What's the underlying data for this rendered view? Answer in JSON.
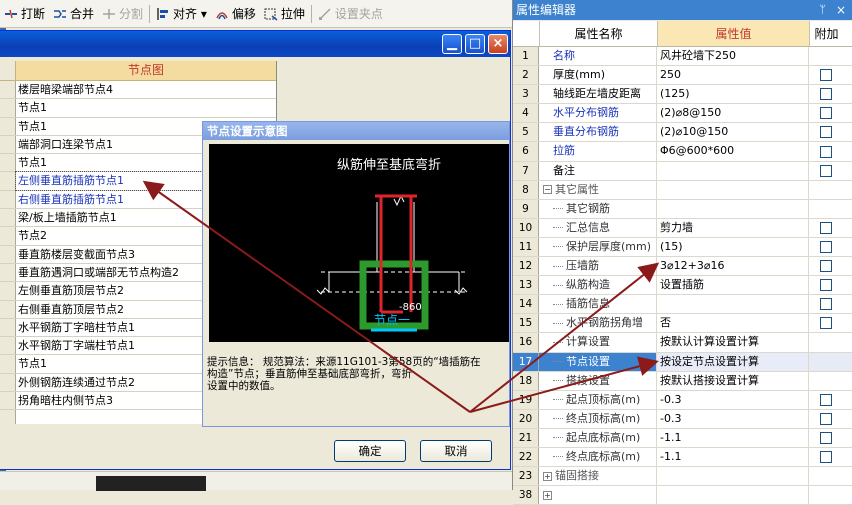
{
  "toolbar": {
    "items": [
      {
        "label": "打断",
        "disabled": false
      },
      {
        "label": "合并",
        "disabled": false
      },
      {
        "label": "分割",
        "disabled": true
      },
      {
        "label": "对齐 ▾",
        "disabled": false
      },
      {
        "label": "偏移",
        "disabled": false
      },
      {
        "label": "拉伸",
        "disabled": false
      },
      {
        "label": "设置夹点",
        "disabled": true
      }
    ]
  },
  "dialog": {
    "list_header": "节点图",
    "rows": [
      "楼层暗梁端部节点4",
      "节点1",
      "节点1",
      "端部洞口连梁节点1",
      "节点1",
      "左侧垂直筋插筋节点1",
      "右侧垂直筋插筋节点1",
      "梁/板上墙插筋节点1",
      "节点2",
      "垂直筋楼层变截面节点3",
      "垂直筋遇洞口或端部无节点构造2",
      "左侧垂直筋顶层节点2",
      "右侧垂直筋顶层节点2",
      "水平钢筋丁字暗柱节点1",
      "水平钢筋丁字端柱节点1",
      "节点1",
      "外侧钢筋连续通过节点2",
      "拐角暗柱内侧节点3",
      ""
    ],
    "ok_label": "确定",
    "cancel_label": "取消"
  },
  "popup": {
    "title": "节点设置示意图",
    "diagram_title": "纵筋伸至基底弯折",
    "diagram_dim": "-860",
    "diagram_label": "节点一",
    "tip": "提示信息：  规范算法：来源11G101-3第58页的“墙插筋在\n构造”节点；垂直筋伸至基础底部弯折，弯折\n设置中的数值。"
  },
  "props": {
    "title": "属性编辑器",
    "pin": "ᛘ",
    "close": "×",
    "headers": {
      "name": "属性名称",
      "value": "属性值",
      "extra": "附加"
    },
    "rows": [
      {
        "no": "1",
        "name": "名称",
        "value": "风井砼墙下250",
        "kind": "blue",
        "check": false
      },
      {
        "no": "2",
        "name": "厚度(mm)",
        "value": "250",
        "kind": "normal",
        "check": true
      },
      {
        "no": "3",
        "name": "轴线距左墙皮距离",
        "value": "(125)",
        "kind": "normal",
        "check": true
      },
      {
        "no": "4",
        "name": "水平分布钢筋",
        "value": "(2)⌀8@150",
        "kind": "blue",
        "check": true
      },
      {
        "no": "5",
        "name": "垂直分布钢筋",
        "value": "(2)⌀10@150",
        "kind": "blue",
        "check": true
      },
      {
        "no": "6",
        "name": "拉筋",
        "value": "Φ6@600*600",
        "kind": "blue",
        "check": true
      },
      {
        "no": "7",
        "name": "备注",
        "value": "",
        "kind": "normal",
        "check": true
      },
      {
        "no": "8",
        "name": "其它属性",
        "value": "",
        "kind": "grp",
        "check": false
      },
      {
        "no": "9",
        "name": "其它钢筋",
        "value": "",
        "kind": "sub",
        "check": false
      },
      {
        "no": "10",
        "name": "汇总信息",
        "value": "剪力墙",
        "kind": "sub",
        "check": true
      },
      {
        "no": "11",
        "name": "保护层厚度(mm)",
        "value": "(15)",
        "kind": "sub",
        "check": true
      },
      {
        "no": "12",
        "name": "压墙筋",
        "value": "3⌀12+3⌀16",
        "kind": "sub",
        "check": true
      },
      {
        "no": "13",
        "name": "纵筋构造",
        "value": "设置插筋",
        "kind": "sub",
        "check": true
      },
      {
        "no": "14",
        "name": "插筋信息",
        "value": "",
        "kind": "sub",
        "check": true
      },
      {
        "no": "15",
        "name": "水平钢筋拐角增",
        "value": "否",
        "kind": "sub",
        "check": true
      },
      {
        "no": "16",
        "name": "计算设置",
        "value": "按默认计算设置计算",
        "kind": "sub",
        "check": false
      },
      {
        "no": "17",
        "name": "节点设置",
        "value": "按设定节点设置计算",
        "kind": "hl",
        "check": false
      },
      {
        "no": "18",
        "name": "搭接设置",
        "value": "按默认搭接设置计算",
        "kind": "sub",
        "check": false
      },
      {
        "no": "19",
        "name": "起点顶标高(m)",
        "value": "-0.3",
        "kind": "sub",
        "check": true
      },
      {
        "no": "20",
        "name": "终点顶标高(m)",
        "value": "-0.3",
        "kind": "sub",
        "check": true
      },
      {
        "no": "21",
        "name": "起点底标高(m)",
        "value": "-1.1",
        "kind": "sub",
        "check": true
      },
      {
        "no": "22",
        "name": "终点底标高(m)",
        "value": "-1.1",
        "kind": "sub",
        "check": true
      },
      {
        "no": "23",
        "name": "锚固搭接",
        "value": "",
        "kind": "grp2",
        "check": false
      },
      {
        "no": "38",
        "name": "",
        "value": "",
        "kind": "grp2",
        "check": false
      }
    ]
  },
  "colors": {
    "arrow": "#8b1a1a",
    "accent": "#3c82cf",
    "diagram_red": "#e0242b",
    "diagram_green": "#2d9a2d"
  }
}
